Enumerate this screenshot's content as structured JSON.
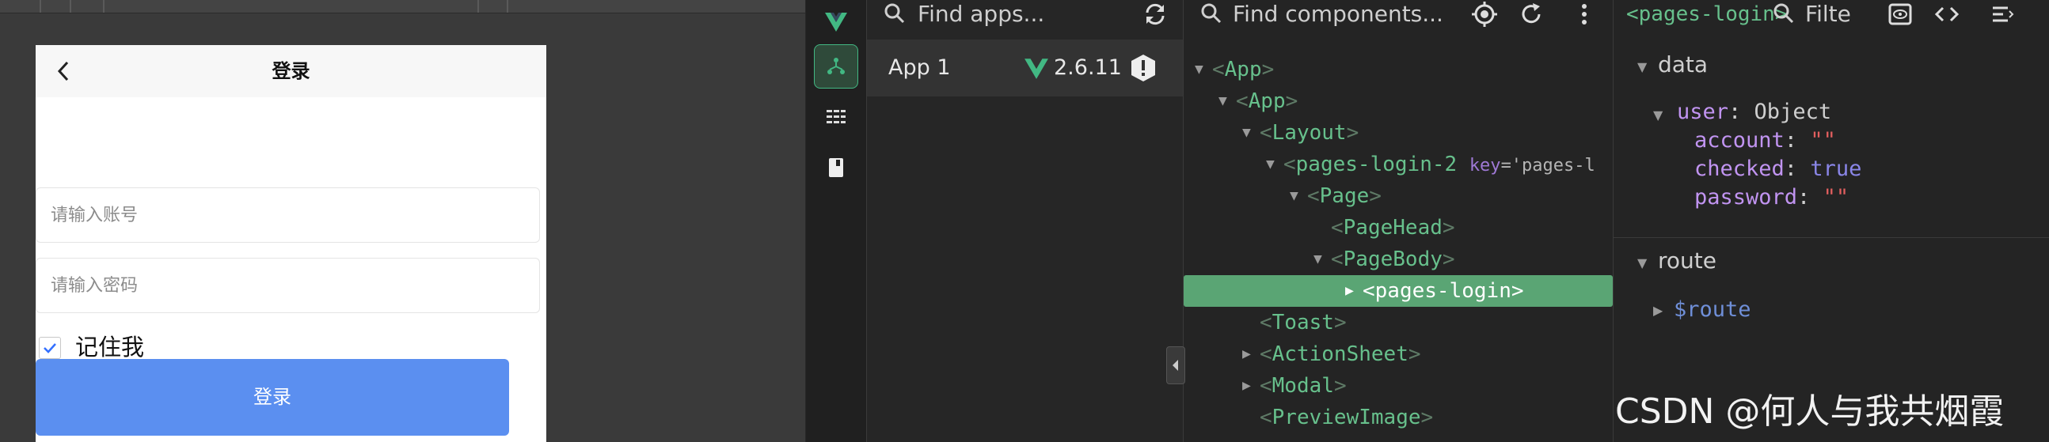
{
  "simulator": {
    "nav_title": "登录",
    "account_placeholder": "请输入账号",
    "password_placeholder": "请输入密码",
    "remember_label": "记住我",
    "remember_checked": true,
    "login_button": "登录"
  },
  "devtools": {
    "sidebar": {
      "logo": "vue-logo-icon",
      "items": [
        "components-tree-icon",
        "timeline-icon",
        "book-icon"
      ]
    },
    "apps": {
      "search_placeholder": "Find apps...",
      "refresh_icon": "refresh-icon",
      "list": [
        {
          "name": "App 1",
          "version": "2.6.11",
          "status_icon": "warning-icon"
        }
      ]
    },
    "components": {
      "search_placeholder": "Find components...",
      "toolbar_icons": [
        "target-icon",
        "refresh-icon",
        "more-vertical-icon"
      ],
      "tree": [
        {
          "name": "App",
          "arrow": "▼"
        },
        {
          "name": "App",
          "arrow": "▼"
        },
        {
          "name": "Layout",
          "arrow": "▼"
        },
        {
          "name": "pages-login-2",
          "arrow": "▼",
          "attr_key": "key",
          "attr_val": "='pages-l"
        },
        {
          "name": "Page",
          "arrow": "▼"
        },
        {
          "name": "PageHead",
          "arrow": ""
        },
        {
          "name": "PageBody",
          "arrow": "▼"
        },
        {
          "name": "pages-login",
          "arrow": "▶",
          "selected": true
        },
        {
          "name": "Toast",
          "arrow": ""
        },
        {
          "name": "ActionSheet",
          "arrow": "▶"
        },
        {
          "name": "Modal",
          "arrow": "▶"
        },
        {
          "name": "PreviewImage",
          "arrow": ""
        }
      ]
    },
    "inspector": {
      "component_tag": "<pages-login>",
      "filter_placeholder": "Filte",
      "toolbar_icons": [
        "eye-icon",
        "code-icon",
        "list-icon"
      ],
      "sections": {
        "data": {
          "title": "data",
          "user_key": "user",
          "user_type": "Object",
          "props": [
            {
              "key": "account",
              "value": "\"\"",
              "kind": "string"
            },
            {
              "key": "checked",
              "value": "true",
              "kind": "bool"
            },
            {
              "key": "password",
              "value": "\"\"",
              "kind": "string"
            }
          ]
        },
        "route": {
          "title": "route",
          "item": "$route"
        }
      }
    }
  },
  "watermark": "CSDN @何人与我共烟霞",
  "colors": {
    "accent_green": "#5aa574",
    "vue_green": "#42b883",
    "login_blue": "#5b8ff0",
    "check_blue": "#3370ff"
  }
}
